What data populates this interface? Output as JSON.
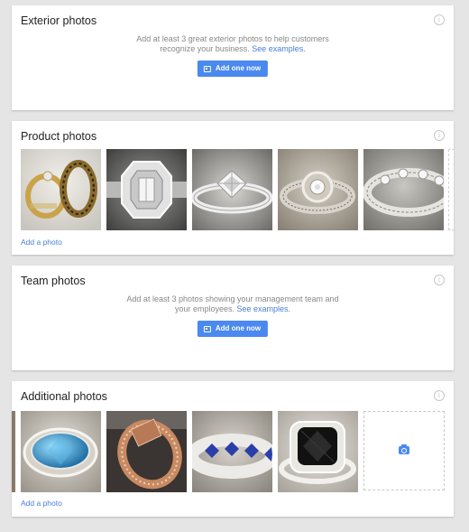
{
  "exterior": {
    "title": "Exterior photos",
    "hint_line1": "Add at least 3 great exterior photos to help customers",
    "hint_line2": "recognize your business.",
    "hint_link": "See examples.",
    "button_label": "Add one now"
  },
  "product": {
    "title": "Product photos",
    "add_link": "Add a photo"
  },
  "team": {
    "title": "Team photos",
    "hint_line1": "Add at least 3 photos showing your management team and",
    "hint_line2": "your employees.",
    "hint_link": "See examples.",
    "button_label": "Add one now"
  },
  "additional": {
    "title": "Additional photos",
    "add_link": "Add a photo"
  },
  "icons": {
    "info": "info-icon",
    "button": "photo-icon",
    "upload": "camera-icon"
  }
}
